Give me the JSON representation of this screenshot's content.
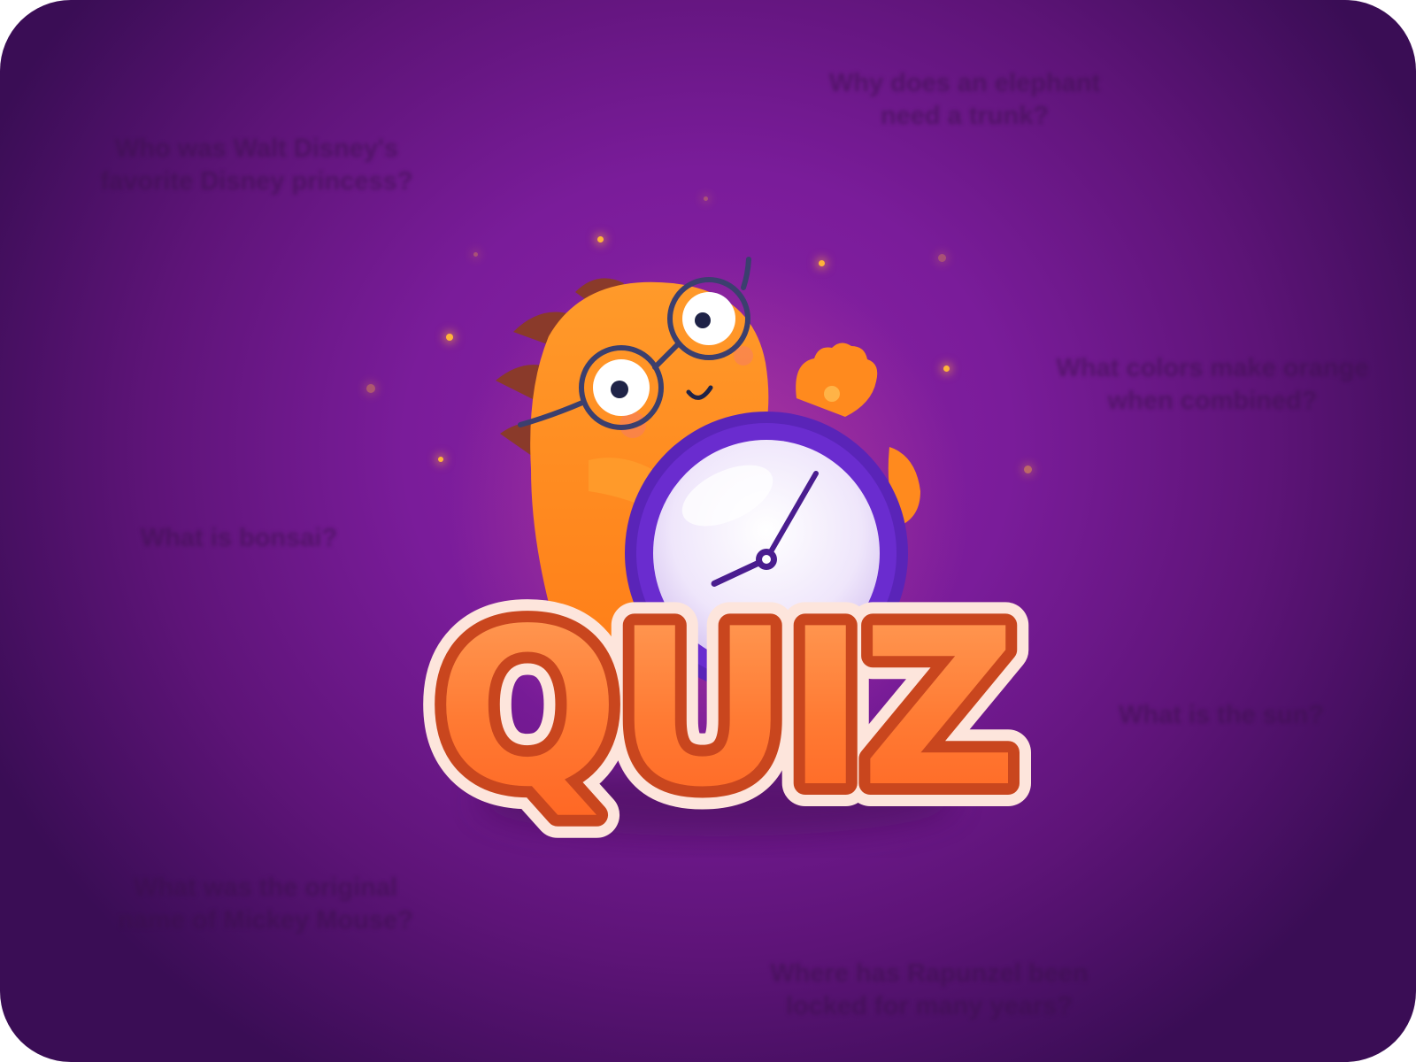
{
  "questions": {
    "q1": [
      "Why does an elephant",
      "need a trunk?"
    ],
    "q2": [
      "Who was Walt Disney's",
      "favorite Disney princess?"
    ],
    "q3": [
      "What colors make orange",
      "when combined?"
    ],
    "q4": [
      "What is bonsai?"
    ],
    "q5": [
      "What is the sun?"
    ],
    "q6": [
      "What was the original",
      "name of Mickey Mouse?"
    ],
    "q7": [
      "Where has Rapunzel been",
      "locked for many years?"
    ]
  },
  "logo": {
    "title": "QUIZ"
  },
  "clock": {
    "hour_hand_angle_deg": 245,
    "minute_hand_angle_deg": 30
  },
  "colors": {
    "background_center": "#8b22a6",
    "background_edge": "#3a0d55",
    "mascot_orange": "#ff8a1e",
    "title_orange": "#ff7a2a",
    "title_outline": "#c9461e",
    "clock_rim": "#6a2ccf",
    "clock_face": "#efe6fb",
    "glasses": "#3b3f6e"
  },
  "icons": {
    "mascot": "orange-dino-with-glasses-icon",
    "clock": "alarm-clock-icon",
    "sparkle": "sparkle-dot-icon"
  }
}
